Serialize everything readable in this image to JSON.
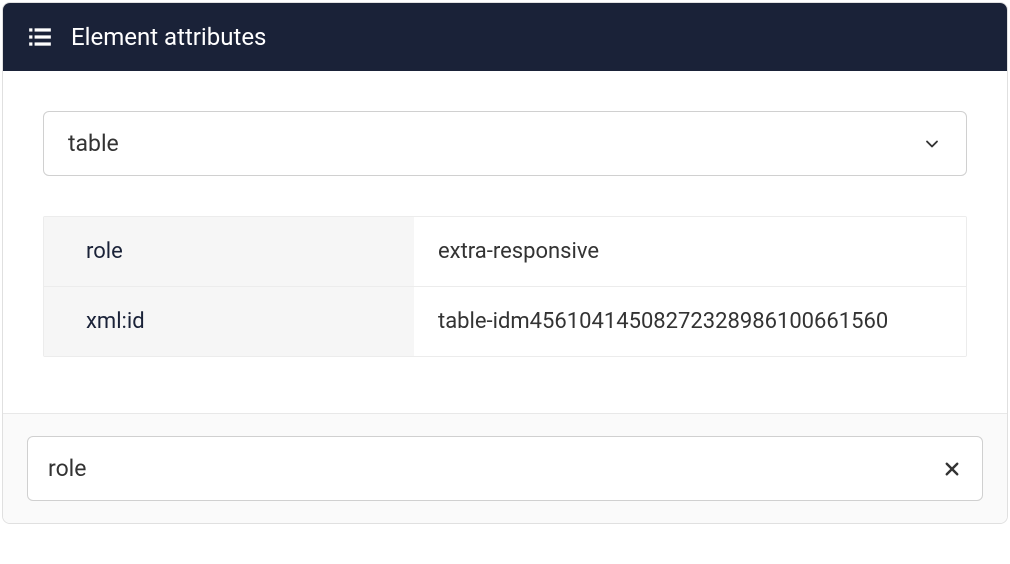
{
  "header": {
    "title": "Element attributes",
    "icon": "list-icon"
  },
  "element_select": {
    "value": "table"
  },
  "attributes": [
    {
      "name": "role",
      "value": "extra-responsive"
    },
    {
      "name": "xml:id",
      "value": "table-idm45610414508272328986100661560"
    }
  ],
  "footer_input": {
    "value": "role"
  }
}
